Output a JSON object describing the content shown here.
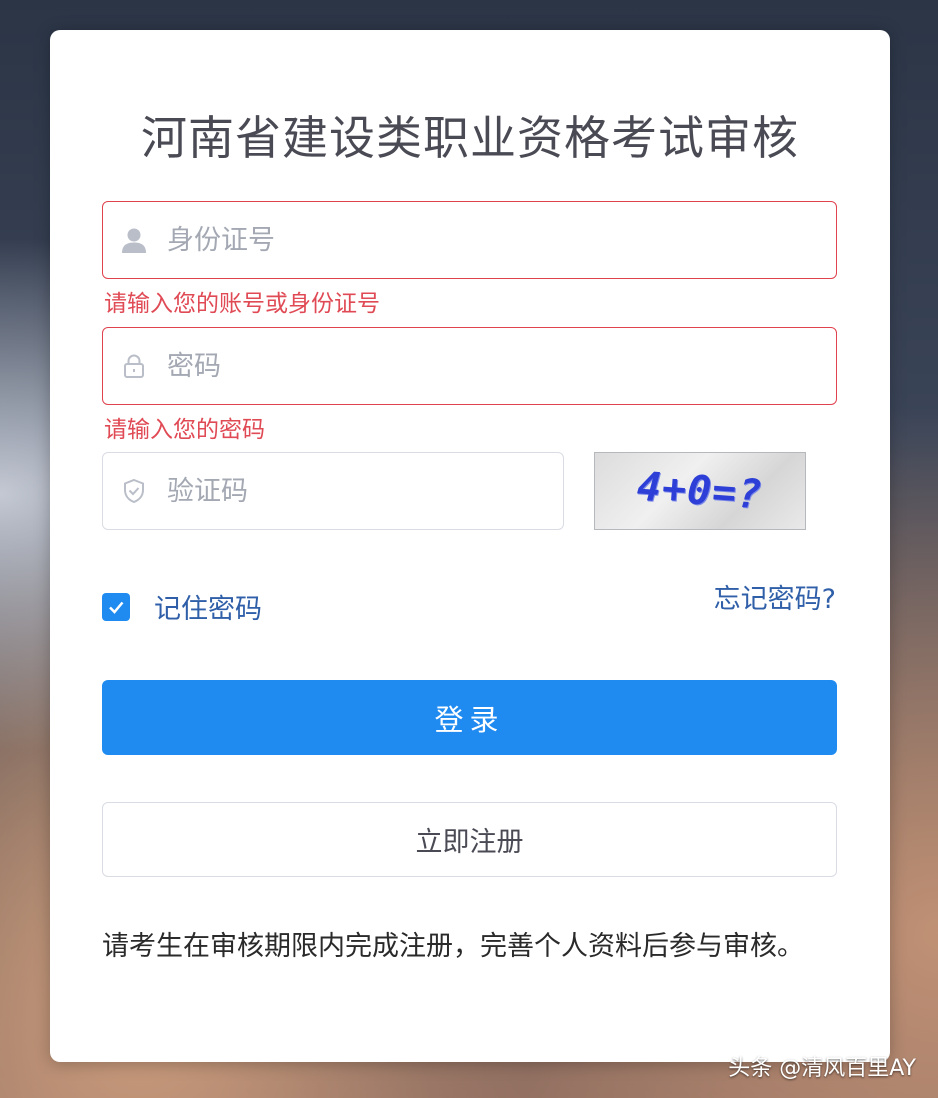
{
  "title": "河南省建设类职业资格考试审核",
  "id_field": {
    "placeholder": "身份证号",
    "icon": "user-icon",
    "error": "请输入您的账号或身份证号"
  },
  "password_field": {
    "placeholder": "密码",
    "icon": "lock-icon",
    "error": "请输入您的密码"
  },
  "captcha_field": {
    "placeholder": "验证码",
    "icon": "shield-icon",
    "image_text": "4+0=?"
  },
  "remember": {
    "label": "记住密码",
    "checked": true
  },
  "forgot_label": "忘记密码?",
  "login_label": "登录",
  "register_label": "立即注册",
  "notice": "请考生在审核期限内完成注册，完善个人资料后参与审核。",
  "watermark": "头条 @清风百里AY",
  "colors": {
    "primary": "#1f8bf0",
    "error": "#e0424e",
    "link": "#2f5fa8"
  }
}
